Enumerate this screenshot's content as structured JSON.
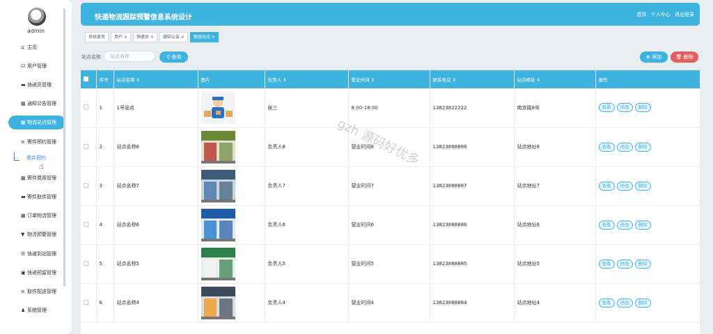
{
  "user": {
    "name": "admin"
  },
  "sidebar": {
    "items": [
      {
        "label": "主页",
        "icon": "home-icon"
      },
      {
        "label": "用户管理",
        "icon": "checkbox-icon"
      },
      {
        "label": "快递员管理",
        "icon": "chat-icon"
      },
      {
        "label": "通知公告管理",
        "icon": "grid-icon"
      },
      {
        "label": "物流站点管理",
        "icon": "grid-icon",
        "active": true
      },
      {
        "label": "寄件预约管理",
        "icon": "list-icon"
      },
      {
        "label": "寄件费用管理",
        "icon": "grid-icon"
      },
      {
        "label": "寄件取件管理",
        "icon": "monitor-icon"
      },
      {
        "label": "订单物流管理",
        "icon": "grid-icon"
      },
      {
        "label": "物流预警管理",
        "icon": "cup-icon"
      },
      {
        "label": "快递到站管理",
        "icon": "sliders-icon"
      },
      {
        "label": "快递预留管理",
        "icon": "clipboard-icon"
      },
      {
        "label": "取件配送管理",
        "icon": "list-icon"
      },
      {
        "label": "系统管理",
        "icon": "person-icon"
      }
    ],
    "submenu": "寄件预约"
  },
  "header": {
    "title": "快递物流跟踪预警信息系统设计",
    "links": [
      "首页",
      "个人中心",
      "退出登录"
    ]
  },
  "tabs": [
    {
      "label": "系统首页",
      "closable": false
    },
    {
      "label": "用户",
      "closable": true
    },
    {
      "label": "快递员",
      "closable": true
    },
    {
      "label": "通知公告",
      "closable": true
    },
    {
      "label": "物流站点",
      "closable": true,
      "active": true
    }
  ],
  "search": {
    "label": "站点名称",
    "placeholder": "站点名称",
    "button": "查询"
  },
  "actions": {
    "add": "添加",
    "delete": "删除"
  },
  "table": {
    "columns": [
      "序号",
      "站点名称",
      "图片",
      "负责人",
      "营业时间",
      "联系电话",
      "站点地址",
      "操作"
    ],
    "row_actions": [
      "查看",
      "修改",
      "删除"
    ],
    "rows": [
      {
        "no": "1",
        "name": "1号站点",
        "image": "courier-illustration",
        "manager": "张三",
        "hours": "8:00-18:00",
        "phone": "13823822222",
        "address": "南京路8号"
      },
      {
        "no": "2",
        "name": "站点名称8",
        "image": "storefront-photo",
        "manager": "负责人8",
        "hours": "营业时间8",
        "phone": "13823888888",
        "address": "站点地址8"
      },
      {
        "no": "3",
        "name": "站点名称7",
        "image": "storefront-photo",
        "manager": "负责人7",
        "hours": "营业时间7",
        "phone": "13823888887",
        "address": "站点地址7"
      },
      {
        "no": "4",
        "name": "站点名称6",
        "image": "storefront-photo",
        "manager": "负责人6",
        "hours": "营业时间6",
        "phone": "13823888886",
        "address": "站点地址6"
      },
      {
        "no": "5",
        "name": "站点名称5",
        "image": "storefront-photo",
        "manager": "负责人5",
        "hours": "营业时间5",
        "phone": "13823888885",
        "address": "站点地址5"
      },
      {
        "no": "6",
        "name": "站点名称4",
        "image": "storefront-photo",
        "manager": "负责人4",
        "hours": "营业时间4",
        "phone": "13823888884",
        "address": "站点地址4"
      }
    ]
  },
  "watermark": "gzh 源码好优多",
  "colors": {
    "accent": "#3fb3e0",
    "danger": "#e06060"
  }
}
